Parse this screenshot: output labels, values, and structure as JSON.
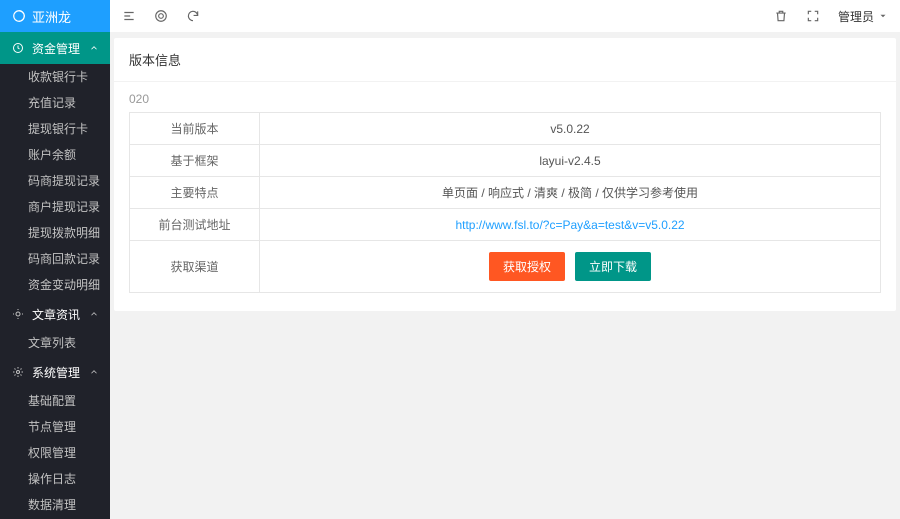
{
  "logo": {
    "text": "亚洲龙"
  },
  "sidebar": {
    "groups": [
      {
        "label": "资金管理",
        "items": [
          {
            "label": "收款银行卡"
          },
          {
            "label": "充值记录"
          },
          {
            "label": "提现银行卡"
          },
          {
            "label": "账户余额"
          },
          {
            "label": "码商提现记录"
          },
          {
            "label": "商户提现记录"
          },
          {
            "label": "提现拨款明细"
          },
          {
            "label": "码商回款记录"
          },
          {
            "label": "资金变动明细"
          }
        ]
      },
      {
        "label": "文章资讯",
        "items": [
          {
            "label": "文章列表"
          }
        ]
      },
      {
        "label": "系统管理",
        "items": [
          {
            "label": "基础配置"
          },
          {
            "label": "节点管理"
          },
          {
            "label": "权限管理"
          },
          {
            "label": "操作日志"
          },
          {
            "label": "数据清理"
          }
        ]
      }
    ]
  },
  "topbar": {
    "admin_label": "管理员"
  },
  "card": {
    "title": "版本信息",
    "small": "020",
    "rows": [
      {
        "k": "当前版本",
        "v": "v5.0.22"
      },
      {
        "k": "基于框架",
        "v": "layui-v2.4.5"
      },
      {
        "k": "主要特点",
        "v": "单页面 / 响应式 / 清爽 / 极简 / 仅供学习参考使用"
      },
      {
        "k": "前台测试地址",
        "v": "http://www.fsl.to/?c=Pay&a=test&v=v5.0.22",
        "link": true
      },
      {
        "k": "获取渠道",
        "btn1": "获取授权",
        "btn2": "立即下载"
      }
    ]
  }
}
